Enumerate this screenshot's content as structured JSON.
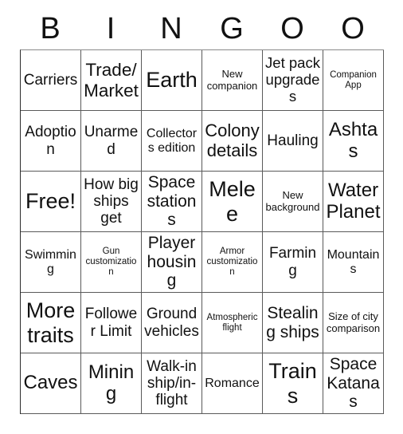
{
  "card": {
    "header_letters": [
      "B",
      "I",
      "N",
      "G",
      "O",
      "O"
    ],
    "columns": 6,
    "rows": 6,
    "background_color": "#ffffff",
    "text_color": "#111111",
    "grid_line_color": "#5a5a5a",
    "cells": [
      [
        {
          "label": "Carriers",
          "size": "md"
        },
        {
          "label": "Trade/ Market",
          "size": "xl"
        },
        {
          "label": "Earth",
          "size": "xxl"
        },
        {
          "label": "New companion",
          "size": "xs"
        },
        {
          "label": "Jet pack upgrades",
          "size": "md"
        },
        {
          "label": "Companion App",
          "size": "xxs"
        }
      ],
      [
        {
          "label": "Adoption",
          "size": "md"
        },
        {
          "label": "Unarmed",
          "size": "md"
        },
        {
          "label": "Collectors edition",
          "size": "sm"
        },
        {
          "label": "Colony details",
          "size": "xl"
        },
        {
          "label": "Hauling",
          "size": "md"
        },
        {
          "label": "Ashtas",
          "size": "xl"
        }
      ],
      [
        {
          "label": "Free!",
          "size": "xxl"
        },
        {
          "label": "How big ships get",
          "size": "md"
        },
        {
          "label": "Space stations",
          "size": "lg"
        },
        {
          "label": "Melee",
          "size": "xxl"
        },
        {
          "label": "New background",
          "size": "xs"
        },
        {
          "label": "Water Planet",
          "size": "xl"
        }
      ],
      [
        {
          "label": "Swimming",
          "size": "sm"
        },
        {
          "label": "Gun customization",
          "size": "xxs"
        },
        {
          "label": "Player housing",
          "size": "lg"
        },
        {
          "label": "Armor customization",
          "size": "xxs"
        },
        {
          "label": "Farming",
          "size": "md"
        },
        {
          "label": "Mountains",
          "size": "sm"
        }
      ],
      [
        {
          "label": "More traits",
          "size": "xxl"
        },
        {
          "label": "Follower Limit",
          "size": "md"
        },
        {
          "label": "Ground vehicles",
          "size": "md"
        },
        {
          "label": "Atmospheric flight",
          "size": "xxs"
        },
        {
          "label": "Stealing ships",
          "size": "lg"
        },
        {
          "label": "Size of city comparison",
          "size": "xs"
        }
      ],
      [
        {
          "label": "Caves",
          "size": "xl"
        },
        {
          "label": "Mining",
          "size": "xl"
        },
        {
          "label": "Walk-in ship/in-flight",
          "size": "md"
        },
        {
          "label": "Romance",
          "size": "sm"
        },
        {
          "label": "Trains",
          "size": "xxl"
        },
        {
          "label": "Space Katanas",
          "size": "lg"
        }
      ]
    ]
  }
}
